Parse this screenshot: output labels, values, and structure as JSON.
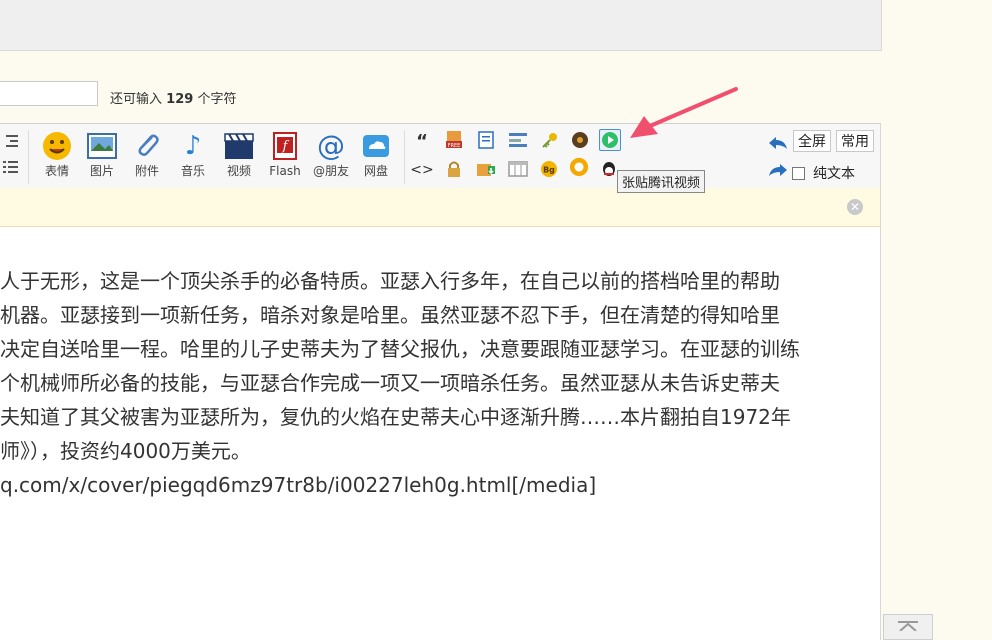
{
  "title_field": {
    "value": "",
    "placeholder": ""
  },
  "char_hint": {
    "prefix": "还可输入",
    "count": "129",
    "suffix": "个字符"
  },
  "toolbar": {
    "tools": [
      {
        "label": "表情",
        "icon": "emoji-icon"
      },
      {
        "label": "图片",
        "icon": "image-icon"
      },
      {
        "label": "附件",
        "icon": "paperclip-icon"
      },
      {
        "label": "音乐",
        "icon": "music-note-icon"
      },
      {
        "label": "视频",
        "icon": "video-clapper-icon"
      },
      {
        "label": "Flash",
        "icon": "flash-icon"
      },
      {
        "label": "@朋友",
        "icon": "at-icon"
      },
      {
        "label": "网盘",
        "icon": "cloud-drive-icon"
      }
    ],
    "fullscreen_label": "全屏",
    "common_label": "常用",
    "plaintext_label": "纯文本",
    "tooltip": "张贴腾讯视频",
    "colors": {
      "highlight": "#4a90d9",
      "arrow": "#f0506e"
    }
  },
  "content": {
    "lines": [
      "人于无形，这是一个顶尖杀手的必备特质。亚瑟入行多年，在自己以前的搭档哈里的帮助",
      "机器。亚瑟接到一项新任务，暗杀对象是哈里。虽然亚瑟不忍下手，但在清楚的得知哈里",
      "决定自送哈里一程。哈里的儿子史蒂夫为了替父报仇，决意要跟随亚瑟学习。在亚瑟的训练",
      "个机械师所必备的技能，与亚瑟合作完成一项又一项暗杀任务。虽然亚瑟从未告诉史蒂夫",
      "夫知道了其父被害为亚瑟所为，复仇的火焰在史蒂夫心中逐渐升腾……本片翻拍自1972年",
      "师》），投资约4000万美元。",
      "q.com/x/cover/piegqd6mz97tr8b/i00227leh0g.html[/media]"
    ]
  }
}
